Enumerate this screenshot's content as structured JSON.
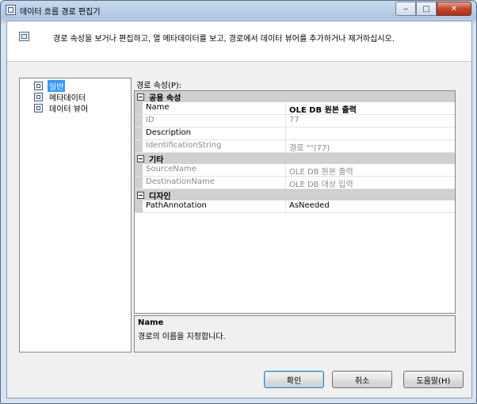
{
  "window": {
    "title": "데이터 흐름 경로 편집기",
    "icon": "editor-window-icon",
    "caption_buttons": {
      "minimize": "‒",
      "maximize": "□",
      "close": "✕"
    }
  },
  "header": {
    "description": "경로 속성을 보거나 편집하고, 열 메타데이터를 보고, 경로에서 데이터 뷰어를 추가하거나 제거하십시오."
  },
  "sidebar": {
    "items": [
      {
        "label": "일반",
        "selected": true
      },
      {
        "label": "메타데이터",
        "selected": false
      },
      {
        "label": "데이터 뷰어",
        "selected": false
      }
    ]
  },
  "properties": {
    "label": "경로 속성(P):",
    "categories": [
      {
        "name": "공용 속성",
        "rows": [
          {
            "name": "Name",
            "value": "OLE DB 원본 출력",
            "readonly": false,
            "bold": true
          },
          {
            "name": "ID",
            "value": "77",
            "readonly": true
          },
          {
            "name": "Description",
            "value": "",
            "readonly": false
          },
          {
            "name": "IdentificationString",
            "value": "경로 \"\"(77)",
            "readonly": true
          }
        ]
      },
      {
        "name": "기타",
        "rows": [
          {
            "name": "SourceName",
            "value": "OLE DB 원본 출력",
            "readonly": true
          },
          {
            "name": "DestinationName",
            "value": "OLE DB 대상 입력",
            "readonly": true
          }
        ]
      },
      {
        "name": "디자인",
        "rows": [
          {
            "name": "PathAnnotation",
            "value": "AsNeeded",
            "readonly": false
          }
        ]
      }
    ]
  },
  "description_panel": {
    "title": "Name",
    "text": "경로의 이름을 지정합니다."
  },
  "buttons": {
    "ok": "확인",
    "cancel": "취소",
    "help": "도움말(H)"
  }
}
